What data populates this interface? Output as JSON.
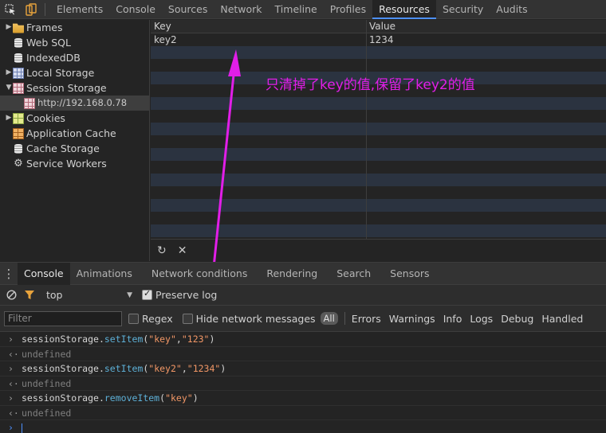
{
  "toolbar": {
    "inspect_icon": "inspect-arrow-icon",
    "device_icon": "device-mode-icon",
    "tabs": [
      "Elements",
      "Console",
      "Sources",
      "Network",
      "Timeline",
      "Profiles",
      "Resources",
      "Security",
      "Audits"
    ],
    "active_tab": "Resources"
  },
  "sidebar": {
    "items": [
      {
        "label": "Frames",
        "icon": "folder-icon",
        "arrow": "right"
      },
      {
        "label": "Web SQL",
        "icon": "database-icon",
        "arrow": ""
      },
      {
        "label": "IndexedDB",
        "icon": "database-icon",
        "arrow": ""
      },
      {
        "label": "Local Storage",
        "icon": "grid-icon",
        "arrow": "right"
      },
      {
        "label": "Session Storage",
        "icon": "grid-icon",
        "arrow": "down"
      },
      {
        "label": "http://192.168.0.78",
        "icon": "grid-icon",
        "arrow": ""
      },
      {
        "label": "Cookies",
        "icon": "cookie-icon",
        "arrow": "right"
      },
      {
        "label": "Application Cache",
        "icon": "appcache-icon",
        "arrow": ""
      },
      {
        "label": "Cache Storage",
        "icon": "database-icon",
        "arrow": ""
      },
      {
        "label": "Service Workers",
        "icon": "gear-icon",
        "arrow": ""
      }
    ],
    "selected": "http://192.168.0.78"
  },
  "storage_table": {
    "headers": {
      "key": "Key",
      "value": "Value"
    },
    "rows": [
      {
        "key": "key2",
        "value": "1234"
      }
    ],
    "footer_icons": [
      "refresh-icon",
      "delete-icon"
    ]
  },
  "annotation": {
    "text": "只清掉了key的值,保留了key2的值",
    "color": "#e11ee8"
  },
  "drawer": {
    "tabs": [
      "Console",
      "Animations",
      "Network conditions",
      "Rendering",
      "Search",
      "Sensors"
    ],
    "active_tab": "Console"
  },
  "console_toolbar": {
    "context": "top",
    "preserve_log_label": "Preserve log",
    "preserve_log_checked": true
  },
  "console_filter": {
    "placeholder": "Filter",
    "regex_label": "Regex",
    "hide_network_label": "Hide network messages",
    "all_label": "All",
    "levels": [
      "Errors",
      "Warnings",
      "Info",
      "Logs",
      "Debug",
      "Handled"
    ]
  },
  "console_log": [
    {
      "type": "in",
      "obj": "sessionStorage",
      "method": "setItem",
      "args": [
        "\"key\"",
        "\"123\""
      ]
    },
    {
      "type": "out",
      "text": "undefined"
    },
    {
      "type": "in",
      "obj": "sessionStorage",
      "method": "setItem",
      "args": [
        "\"key2\"",
        "\"1234\""
      ]
    },
    {
      "type": "out",
      "text": "undefined"
    },
    {
      "type": "in",
      "obj": "sessionStorage",
      "method": "removeItem",
      "args": [
        "\"key\""
      ]
    },
    {
      "type": "out",
      "text": "undefined"
    }
  ],
  "colors": {
    "active_tab_underline": "#4d90fe",
    "method": "#5db0d7",
    "string": "#f29766",
    "filter_icon": "#e8a33c"
  }
}
